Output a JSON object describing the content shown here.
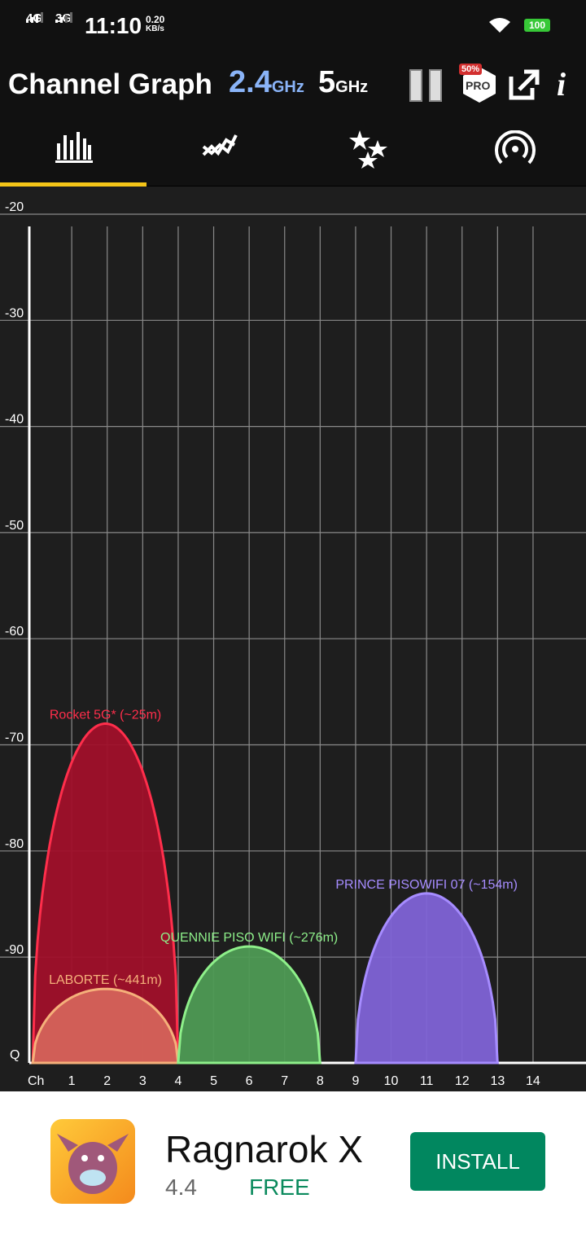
{
  "status_bar": {
    "net1": "4G",
    "net2": "3G",
    "time": "11:10",
    "speed_value": "0.20",
    "speed_unit": "KB/s",
    "battery": "100"
  },
  "app_bar": {
    "title": "Channel Graph",
    "band_24": "2.4",
    "band_24_unit": "GHz",
    "band_5": "5",
    "band_5_unit": "GHz",
    "pro_badge": "PRO",
    "pro_discount": "50%",
    "icons": [
      "pause-icon",
      "pro-badge-icon",
      "share-icon",
      "info-icon"
    ],
    "active_band_color": "#8ab4f8"
  },
  "tabs": [
    {
      "icon": "bar-chart-icon",
      "active": true
    },
    {
      "icon": "time-graph-icon",
      "active": false
    },
    {
      "icon": "stars-icon",
      "active": false
    },
    {
      "icon": "signal-icon",
      "active": false
    }
  ],
  "chart_data": {
    "type": "area",
    "x_axis_label": "Ch",
    "y_axis_bottom_label": "Q",
    "ylim": [
      -98.5,
      -20
    ],
    "y_ticks": [
      "-20",
      "-30",
      "-40",
      "-50",
      "-60",
      "-70",
      "-80",
      "-90"
    ],
    "x_ticks": [
      "1",
      "2",
      "3",
      "4",
      "5",
      "6",
      "7",
      "8",
      "9",
      "10",
      "11",
      "12",
      "13",
      "14"
    ],
    "series": [
      {
        "name": "Rocket 5G* (~25m)",
        "center_channel": 2,
        "from_channel": -0.1,
        "to_channel": 4.0,
        "signal_dbm": -68,
        "color": "#ff2e4b",
        "fill": "#a0102a"
      },
      {
        "name": "LABORTE (~441m)",
        "center_channel": 2,
        "from_channel": -0.1,
        "to_channel": 4.0,
        "signal_dbm": -93,
        "color": "#f5b07a",
        "fill": "#d4635a"
      },
      {
        "name": "QUENNIE PISO WIFI (~276m)",
        "center_channel": 6,
        "from_channel": 4.0,
        "to_channel": 8.0,
        "signal_dbm": -89,
        "color": "#8ef08a",
        "fill": "#4e9a54"
      },
      {
        "name": "PRINCE PISOWIFI 07 (~154m)",
        "center_channel": 11,
        "from_channel": 9.0,
        "to_channel": 13.0,
        "signal_dbm": -84,
        "color": "#a68cff",
        "fill": "#7f63d6"
      }
    ]
  },
  "ad": {
    "app_name": "Ragnarok X",
    "rating": "4.4",
    "price": "FREE",
    "install_label": "INSTALL"
  }
}
